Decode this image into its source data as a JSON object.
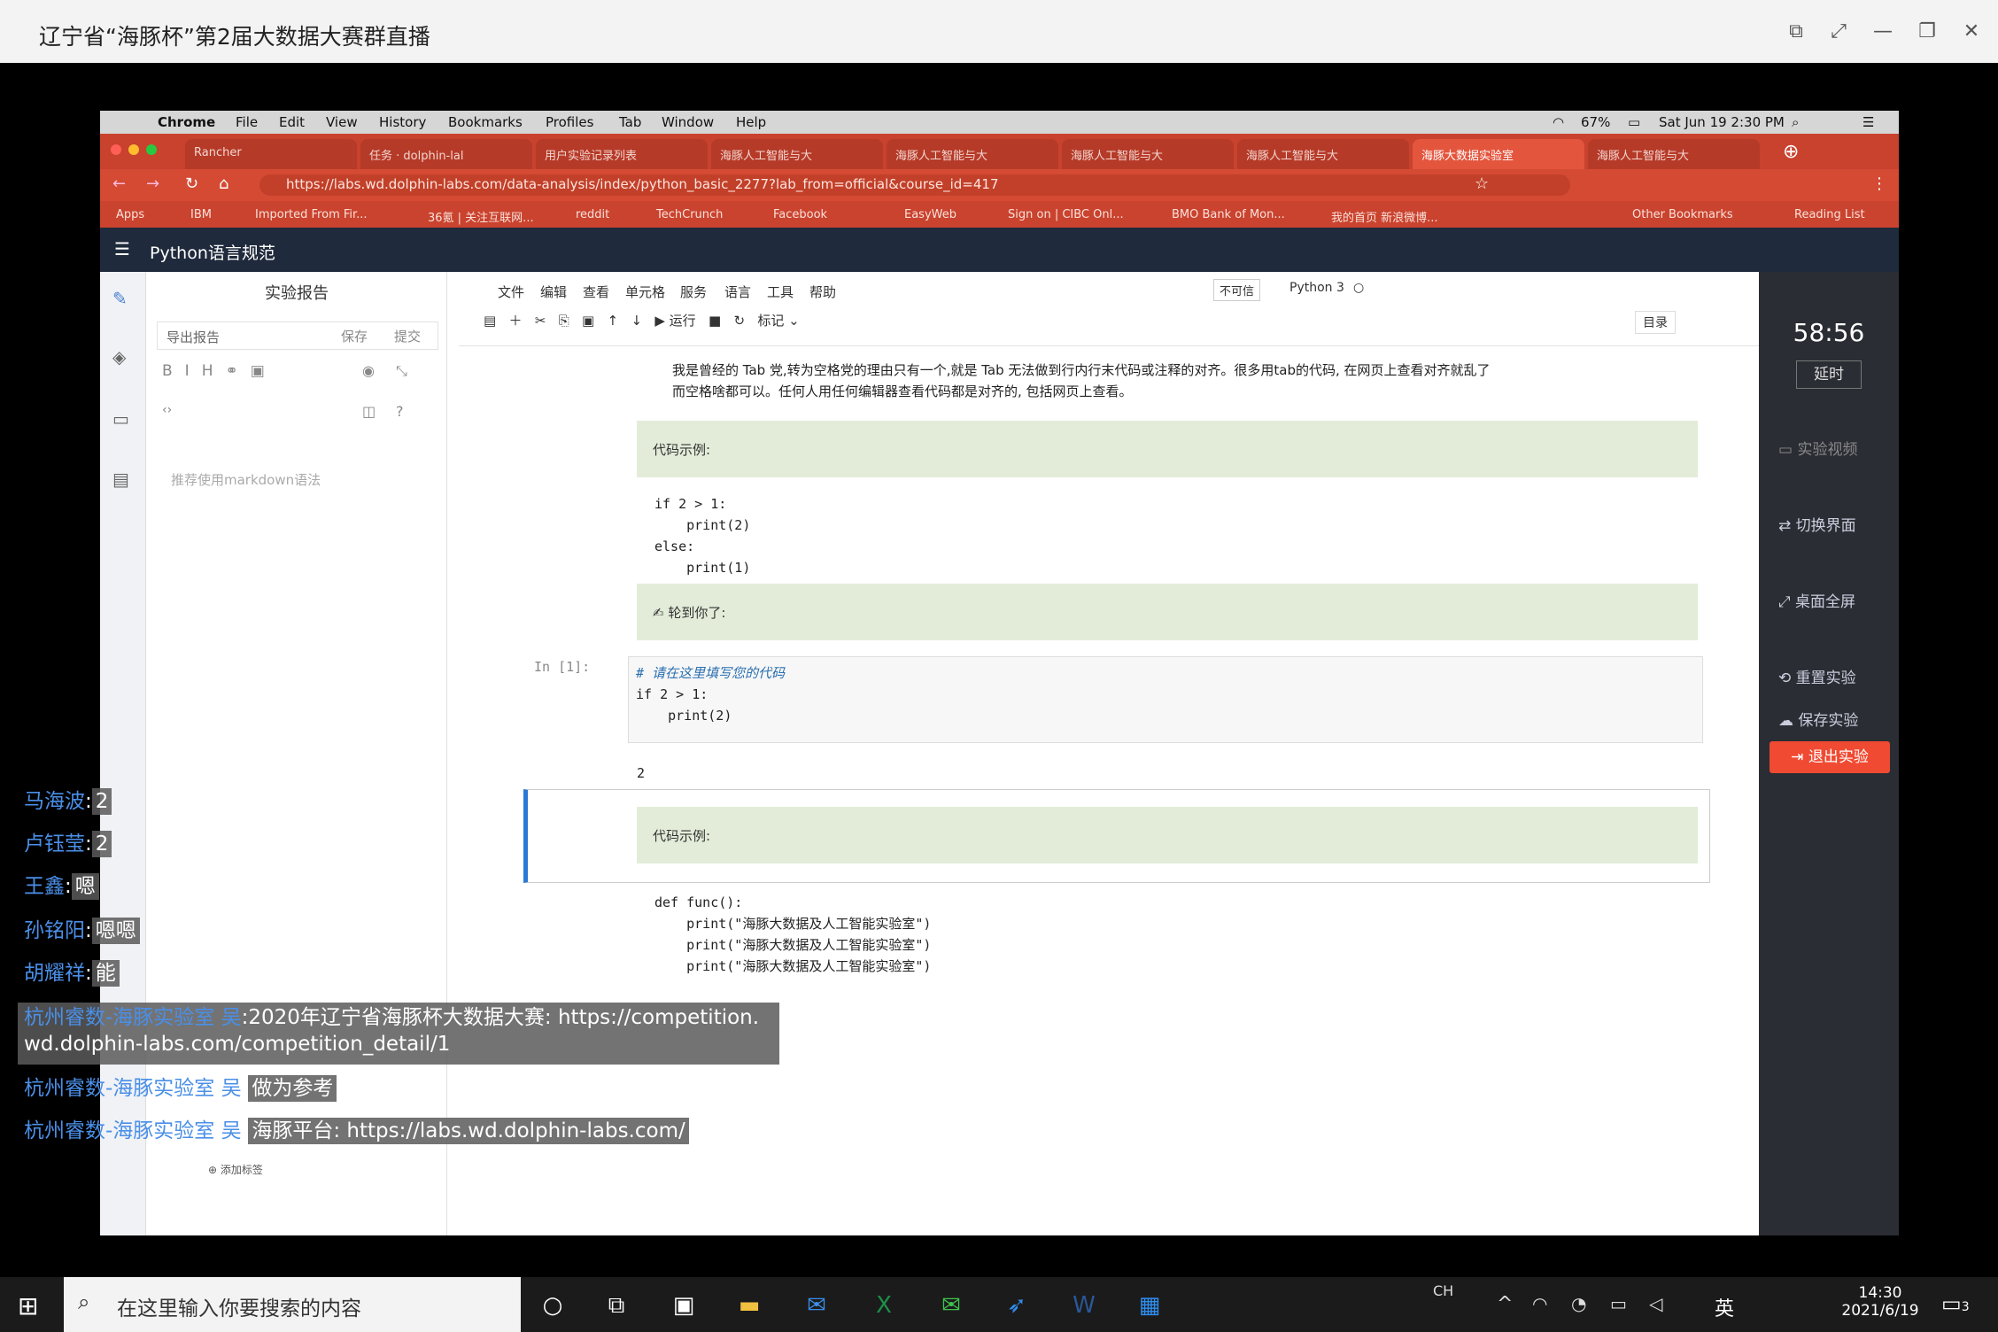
{
  "window": {
    "title": "辽宁省“海豚杯”第2届大数据大赛群直播"
  },
  "mac_menu": {
    "apple": "",
    "app": "Chrome",
    "items": [
      "File",
      "Edit",
      "View",
      "History",
      "Bookmarks",
      "Profiles",
      "Tab",
      "Window",
      "Help"
    ],
    "battery": "67%",
    "datetime": "Sat Jun 19  2:30 PM"
  },
  "tabs": [
    "Rancher",
    "任务 · dolphin-lal",
    "用户实验记录列表",
    "海豚人工智能与大",
    "海豚人工智能与大",
    "海豚人工智能与大",
    "海豚人工智能与大",
    "海豚大数据实验室",
    "海豚人工智能与大"
  ],
  "address": {
    "url": "https://labs.wd.dolphin-labs.com/data-analysis/index/python_basic_2277?lab_from=official&course_id=417"
  },
  "bookmarks": [
    "Apps",
    "IBM",
    "Imported From Fir...",
    "36氪 | 关注互联网...",
    "reddit",
    "TechCrunch",
    "Facebook",
    "EasyWeb",
    "Sign on | CIBC Onl...",
    "BMO Bank of Mon...",
    "我的首页 新浪微博...",
    "Other Bookmarks",
    "Reading List"
  ],
  "app": {
    "title": "Python语言规范"
  },
  "report": {
    "title": "实验报告",
    "export": "导出报告",
    "save": "保存",
    "submit": "提交",
    "placeholder": "推荐使用markdown语法",
    "add_label": "添加标签"
  },
  "toolbar_menu": [
    "文件",
    "编辑",
    "查看",
    "单元格",
    "服务",
    "语言",
    "工具",
    "帮助"
  ],
  "notebook": {
    "trusted": "不可信",
    "kernel": "Python 3",
    "run": "运行",
    "cell_type": "标记",
    "toc": "目录",
    "text1": "我是曾经的 Tab 党,转为空格党的理由只有一个,就是 Tab 无法做到行内行末代码或注释的对齐。很多用tab的代码, 在网页上查看对齐就乱了",
    "text2": "而空格啥都可以。任何人用任何编辑器查看代码都是对齐的, 包括网页上查看。",
    "example_label": "代码示例:",
    "code1": "if 2 > 1:\n    print(2)\nelse:\n    print(1)",
    "your_turn": "✍ 轮到你了:",
    "prompt": "In [1]:",
    "code2_comment": "# 请在这里填写您的代码",
    "code2": "if 2 > 1:\n    print(2)",
    "output": "2",
    "example_label2": "代码示例:",
    "code3": "def func():\n    print(\"海豚大数据及人工智能实验室\")\n    print(\"海豚大数据及人工智能实验室\")\n    print(\"海豚大数据及人工智能实验室\")"
  },
  "right_panel": {
    "timer": "58:56",
    "delay": "延时",
    "video": "实验视频",
    "switch": "切换界面",
    "fullscreen": "桌面全屏",
    "reset": "重置实验",
    "save": "保存实验",
    "exit": "退出实验"
  },
  "chat": [
    {
      "name": "马海波",
      "text": "2"
    },
    {
      "name": "卢钰莹",
      "text": "2"
    },
    {
      "name": "王鑫",
      "text": "嗯"
    },
    {
      "name": "孙铭阳",
      "text": "嗯嗯"
    },
    {
      "name": "胡耀祥",
      "text": "能"
    },
    {
      "name": "杭州睿数-海豚实验室 吴",
      "text": "2020年辽宁省海豚杯大数据大赛:  https://competition.",
      "text2": "wd.dolphin-labs.com/competition_detail/1"
    },
    {
      "name": "杭州睿数-海豚实验室 吴",
      "text": "做为参考"
    },
    {
      "name": "杭州睿数-海豚实验室 吴",
      "text": "海豚平台:  https://labs.wd.dolphin-labs.com/"
    }
  ],
  "taskbar": {
    "search_placeholder": "在这里输入你要搜索的内容",
    "ime1": "CH",
    "ime2": "英",
    "time": "14:30",
    "date": "2021/6/19",
    "notif": "3"
  }
}
